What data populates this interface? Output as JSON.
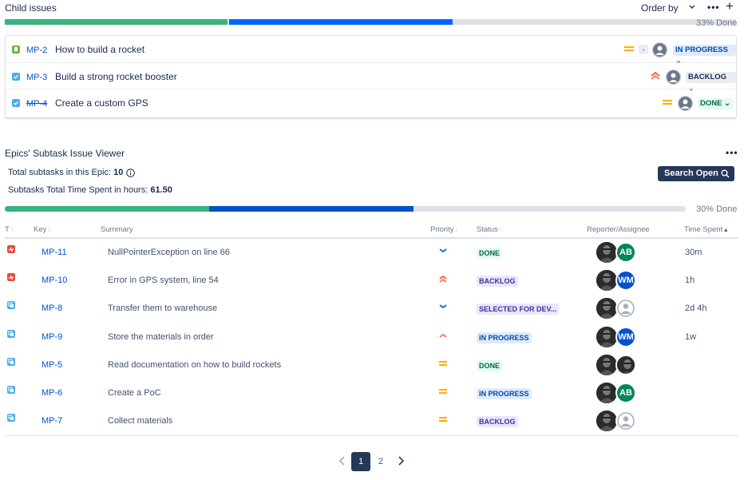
{
  "child_issues": {
    "title": "Child issues",
    "order_by_label": "Order by",
    "progress_text": "33% Done",
    "progress": {
      "done": 0.305,
      "in_progress": 0.305
    },
    "colors": {
      "done": "#36b37e",
      "in_progress": "#0065ff",
      "todo": "#dfe1e6"
    },
    "items": [
      {
        "key": "MP-2",
        "summary": "How to build a rocket",
        "type_icon": "story-icon",
        "priority": "medium",
        "status": "IN PROGRESS",
        "estimate": "-",
        "done": false
      },
      {
        "key": "MP-3",
        "summary": "Build a strong rocket booster",
        "type_icon": "task-icon",
        "priority": "highest",
        "status": "BACKLOG",
        "done": false
      },
      {
        "key": "MP-4",
        "summary": "Create a custom GPS",
        "type_icon": "task-icon",
        "priority": "medium",
        "status": "DONE",
        "done": true
      }
    ]
  },
  "epic_viewer": {
    "title": "Epics' Subtask Issue Viewer",
    "total_label": "Total subtasks in this Epic:",
    "total_value": "10",
    "time_label": "Subtasks Total Time Spent in hours:",
    "time_value": "61.50",
    "search_button": "Search Open",
    "progress_text": "30% Done",
    "progress": {
      "done": 0.3,
      "in_progress": 0.3
    },
    "columns": {
      "type": "T",
      "key": "Key",
      "summary": "Summary",
      "priority": "Priority",
      "status": "Status",
      "reporter": "Reporter/Assignee",
      "time": "Time Spent"
    },
    "rows": [
      {
        "type": "bug-icon",
        "key": "MP-11",
        "summary": "NullPointerException on line 66",
        "priority": "low",
        "status": "DONE",
        "assignee": "AB",
        "assignee_color": "#00875a",
        "time": "30m"
      },
      {
        "type": "bug-icon",
        "key": "MP-10",
        "summary": "Error in GPS system, line 54",
        "priority": "highest",
        "status": "BACKLOG",
        "assignee": "WM",
        "assignee_color": "#0052cc",
        "time": "1h"
      },
      {
        "type": "subtask-icon",
        "key": "MP-8",
        "summary": "Transfer them to warehouse",
        "priority": "low",
        "status": "SELECTED FOR DEV...",
        "assignee": "",
        "assignee_color": "#ffffff",
        "time": "2d 4h"
      },
      {
        "type": "subtask-icon",
        "key": "MP-9",
        "summary": "Store the materials in order",
        "priority": "high",
        "status": "IN PROGRESS",
        "assignee": "WM",
        "assignee_color": "#0052cc",
        "time": "1w"
      },
      {
        "type": "subtask-icon",
        "key": "MP-5",
        "summary": "Read documentation on how to build rockets",
        "priority": "medium",
        "status": "DONE",
        "assignee": "photo",
        "assignee_color": "#1e1e1e",
        "time": ""
      },
      {
        "type": "subtask-icon",
        "key": "MP-6",
        "summary": "Create a PoC",
        "priority": "medium",
        "status": "IN PROGRESS",
        "assignee": "AB",
        "assignee_color": "#00875a",
        "time": ""
      },
      {
        "type": "subtask-icon",
        "key": "MP-7",
        "summary": "Collect materials",
        "priority": "medium",
        "status": "BACKLOG",
        "assignee": "",
        "assignee_color": "#ffffff",
        "time": ""
      }
    ],
    "pagination": {
      "pages": [
        "1",
        "2"
      ],
      "current": "1"
    }
  }
}
